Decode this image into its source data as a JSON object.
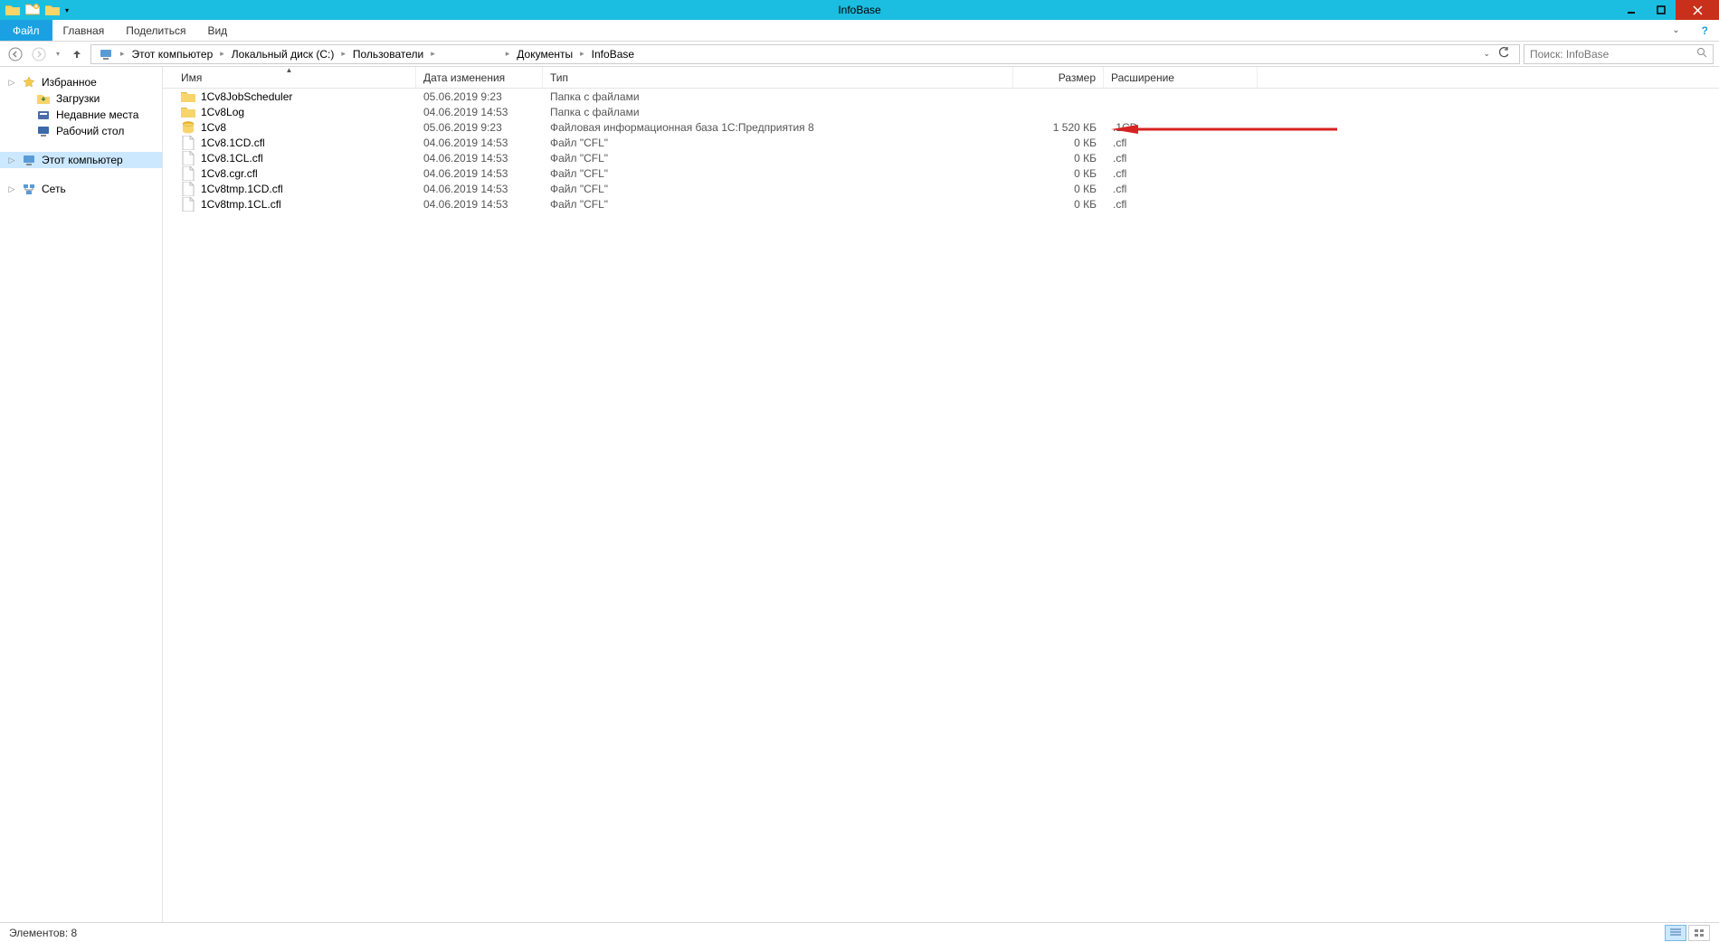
{
  "window": {
    "title": "InfoBase"
  },
  "ribbon": {
    "file": "Файл",
    "tabs": [
      "Главная",
      "Поделиться",
      "Вид"
    ]
  },
  "breadcrumb": {
    "segments": [
      "Этот компьютер",
      "Локальный диск (C:)",
      "Пользователи",
      "",
      "Документы",
      "InfoBase"
    ]
  },
  "search": {
    "placeholder": "Поиск: InfoBase"
  },
  "sidebar": {
    "favorites": "Избранное",
    "downloads": "Загрузки",
    "recent": "Недавние места",
    "desktop": "Рабочий стол",
    "thispc": "Этот компьютер",
    "network": "Сеть"
  },
  "columns": {
    "name": "Имя",
    "date": "Дата изменения",
    "type": "Тип",
    "size": "Размер",
    "ext": "Расширение"
  },
  "files": [
    {
      "icon": "folder",
      "name": "1Cv8JobScheduler",
      "date": "05.06.2019 9:23",
      "type": "Папка с файлами",
      "size": "",
      "ext": ""
    },
    {
      "icon": "folder",
      "name": "1Cv8Log",
      "date": "04.06.2019 14:53",
      "type": "Папка с файлами",
      "size": "",
      "ext": ""
    },
    {
      "icon": "db",
      "name": "1Cv8",
      "date": "05.06.2019 9:23",
      "type": "Файловая информационная база 1С:Предприятия 8",
      "size": "1 520 КБ",
      "ext": ".1CD"
    },
    {
      "icon": "file",
      "name": "1Cv8.1CD.cfl",
      "date": "04.06.2019 14:53",
      "type": "Файл \"CFL\"",
      "size": "0 КБ",
      "ext": ".cfl"
    },
    {
      "icon": "file",
      "name": "1Cv8.1CL.cfl",
      "date": "04.06.2019 14:53",
      "type": "Файл \"CFL\"",
      "size": "0 КБ",
      "ext": ".cfl"
    },
    {
      "icon": "file",
      "name": "1Cv8.cgr.cfl",
      "date": "04.06.2019 14:53",
      "type": "Файл \"CFL\"",
      "size": "0 КБ",
      "ext": ".cfl"
    },
    {
      "icon": "file",
      "name": "1Cv8tmp.1CD.cfl",
      "date": "04.06.2019 14:53",
      "type": "Файл \"CFL\"",
      "size": "0 КБ",
      "ext": ".cfl"
    },
    {
      "icon": "file",
      "name": "1Cv8tmp.1CL.cfl",
      "date": "04.06.2019 14:53",
      "type": "Файл \"CFL\"",
      "size": "0 КБ",
      "ext": ".cfl"
    }
  ],
  "status": {
    "items_label": "Элементов:",
    "count": "8"
  }
}
